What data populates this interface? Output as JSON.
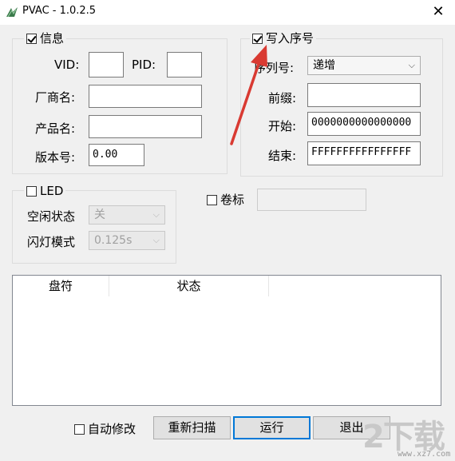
{
  "window": {
    "title": "PVAC - 1.0.2.5",
    "close_glyph": "✕"
  },
  "info_group": {
    "label": "信息",
    "checked": true,
    "vid_label": "VID:",
    "vid_value": "",
    "pid_label": "PID:",
    "pid_value": "",
    "vendor_label": "厂商名:",
    "vendor_value": "",
    "product_label": "产品名:",
    "product_value": "",
    "version_label": "版本号:",
    "version_value": "0.00"
  },
  "serial_group": {
    "label": "写入序号",
    "checked": true,
    "seq_label": "序列号:",
    "seq_value": "递增",
    "prefix_label": "前缀:",
    "prefix_value": "",
    "start_label": "开始:",
    "start_value": "0000000000000000",
    "end_label": "结束:",
    "end_value": "FFFFFFFFFFFFFFFF"
  },
  "led_group": {
    "label": "LED",
    "checked": false,
    "idle_label": "空闲状态",
    "idle_value": "关",
    "blink_label": "闪灯模式",
    "blink_value": "0.125s"
  },
  "volume": {
    "label": "卷标",
    "checked": false,
    "value": ""
  },
  "drive_table": {
    "columns": [
      "盘符",
      "状态"
    ],
    "rows": []
  },
  "bottom": {
    "auto_fix_label": "自动修改",
    "auto_fix_checked": false,
    "rescan_label": "重新扫描",
    "run_label": "运行",
    "exit_label": "退出"
  },
  "watermark": {
    "text": "2下载",
    "sub": "www.xz7.com"
  },
  "colors": {
    "arrow": "#d93a32",
    "default_button_border": "#0078d7"
  },
  "icons": {
    "app": "app-icon",
    "close": "close-icon",
    "arrow": "red-arrow-annotation"
  }
}
